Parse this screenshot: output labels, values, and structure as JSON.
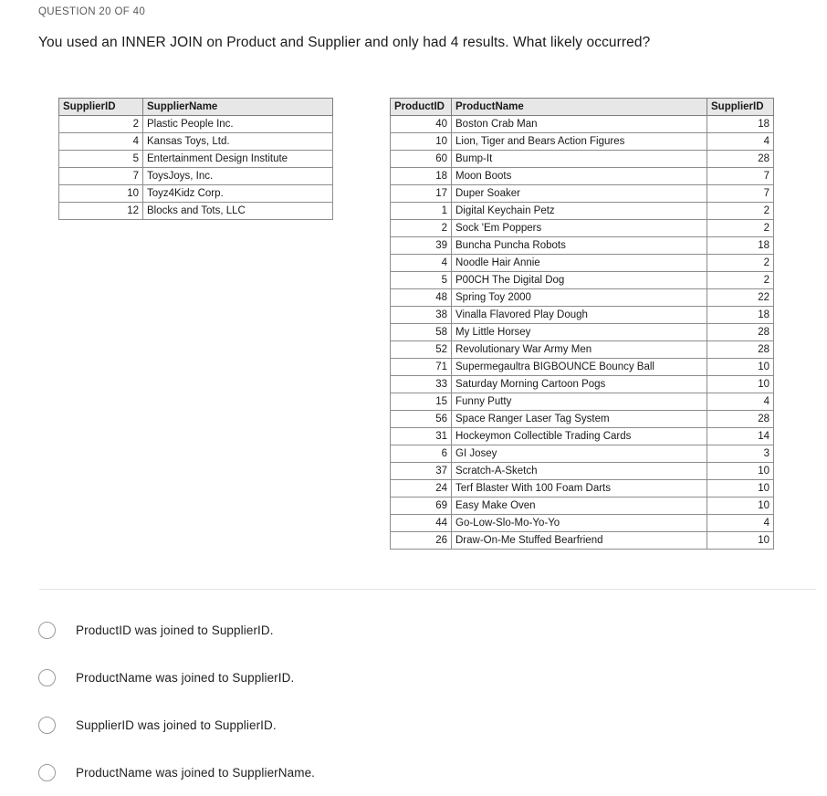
{
  "header": {
    "question_counter": "QUESTION 20 OF 40",
    "question_text": "You used an INNER JOIN on Product and Supplier and only had 4 results. What likely occurred?"
  },
  "supplier_table": {
    "columns": [
      "SupplierID",
      "SupplierName"
    ],
    "rows": [
      {
        "SupplierID": "2",
        "SupplierName": "Plastic People Inc."
      },
      {
        "SupplierID": "4",
        "SupplierName": "Kansas Toys, Ltd."
      },
      {
        "SupplierID": "5",
        "SupplierName": "Entertainment Design Institute"
      },
      {
        "SupplierID": "7",
        "SupplierName": "ToysJoys, Inc."
      },
      {
        "SupplierID": "10",
        "SupplierName": "Toyz4Kidz Corp."
      },
      {
        "SupplierID": "12",
        "SupplierName": "Blocks and Tots, LLC"
      }
    ]
  },
  "product_table": {
    "columns": [
      "ProductID",
      "ProductName",
      "SupplierID"
    ],
    "rows": [
      {
        "ProductID": "40",
        "ProductName": "Boston Crab Man",
        "SupplierID": "18"
      },
      {
        "ProductID": "10",
        "ProductName": "Lion, Tiger and Bears Action Figures",
        "SupplierID": "4"
      },
      {
        "ProductID": "60",
        "ProductName": "Bump-It",
        "SupplierID": "28"
      },
      {
        "ProductID": "18",
        "ProductName": "Moon Boots",
        "SupplierID": "7"
      },
      {
        "ProductID": "17",
        "ProductName": "Duper Soaker",
        "SupplierID": "7"
      },
      {
        "ProductID": "1",
        "ProductName": "Digital Keychain Petz",
        "SupplierID": "2"
      },
      {
        "ProductID": "2",
        "ProductName": "Sock 'Em Poppers",
        "SupplierID": "2"
      },
      {
        "ProductID": "39",
        "ProductName": "Buncha Puncha Robots",
        "SupplierID": "18"
      },
      {
        "ProductID": "4",
        "ProductName": "Noodle Hair Annie",
        "SupplierID": "2"
      },
      {
        "ProductID": "5",
        "ProductName": "P00CH The Digital Dog",
        "SupplierID": "2"
      },
      {
        "ProductID": "48",
        "ProductName": "Spring Toy 2000",
        "SupplierID": "22"
      },
      {
        "ProductID": "38",
        "ProductName": "Vinalla Flavored Play Dough",
        "SupplierID": "18"
      },
      {
        "ProductID": "58",
        "ProductName": "My Little Horsey",
        "SupplierID": "28"
      },
      {
        "ProductID": "52",
        "ProductName": "Revolutionary War Army Men",
        "SupplierID": "28"
      },
      {
        "ProductID": "71",
        "ProductName": "Supermegaultra BIGBOUNCE Bouncy Ball",
        "SupplierID": "10"
      },
      {
        "ProductID": "33",
        "ProductName": "Saturday Morning Cartoon Pogs",
        "SupplierID": "10"
      },
      {
        "ProductID": "15",
        "ProductName": "Funny Putty",
        "SupplierID": "4"
      },
      {
        "ProductID": "56",
        "ProductName": "Space Ranger Laser Tag System",
        "SupplierID": "28"
      },
      {
        "ProductID": "31",
        "ProductName": "Hockeymon Collectible Trading Cards",
        "SupplierID": "14"
      },
      {
        "ProductID": "6",
        "ProductName": "GI Josey",
        "SupplierID": "3"
      },
      {
        "ProductID": "37",
        "ProductName": "Scratch-A-Sketch",
        "SupplierID": "10"
      },
      {
        "ProductID": "24",
        "ProductName": "Terf Blaster With 100 Foam Darts",
        "SupplierID": "10"
      },
      {
        "ProductID": "69",
        "ProductName": "Easy Make Oven",
        "SupplierID": "10"
      },
      {
        "ProductID": "44",
        "ProductName": "Go-Low-Slo-Mo-Yo-Yo",
        "SupplierID": "4"
      },
      {
        "ProductID": "26",
        "ProductName": "Draw-On-Me Stuffed Bearfriend",
        "SupplierID": "10"
      }
    ]
  },
  "answers": {
    "options": [
      {
        "label": "ProductID was joined to SupplierID.",
        "selected": false
      },
      {
        "label": "ProductName was joined to SupplierID.",
        "selected": false
      },
      {
        "label": "SupplierID was joined to SupplierID.",
        "selected": false
      },
      {
        "label": "ProductName was joined to SupplierName.",
        "selected": false
      }
    ]
  },
  "colors": {
    "header_fill": "#e7e7e7",
    "table_border": "#8d8d8d",
    "divider": "#e2e2e4",
    "counter_text": "#5a5a5a",
    "body_text": "#1f1f1f"
  }
}
